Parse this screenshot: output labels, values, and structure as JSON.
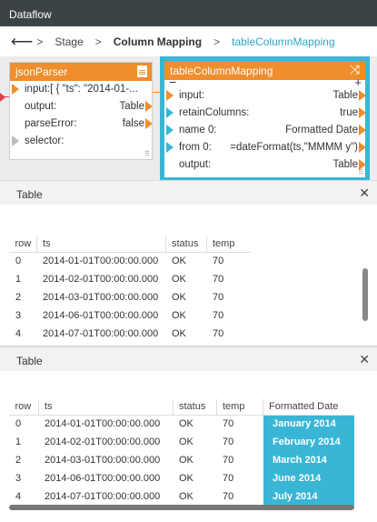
{
  "window": {
    "title": "Dataflow"
  },
  "breadcrumb": {
    "back_icon": "back-arrow-icon",
    "items": [
      "Stage",
      "Column Mapping",
      "tableColumnMapping"
    ]
  },
  "nodes": {
    "json_parser": {
      "title": "jsonParser",
      "rows": [
        {
          "label": "input:",
          "value": "[ { \"ts\": \"2014-01-..."
        },
        {
          "label": "output:",
          "value": "Table"
        },
        {
          "label": "parseError:",
          "value": "false"
        },
        {
          "label": "selector:",
          "value": ""
        }
      ]
    },
    "table_column_mapping": {
      "title": "tableColumnMapping",
      "rows": [
        {
          "label": "input:",
          "value": "Table"
        },
        {
          "label": "retainColumns:",
          "value": "true"
        },
        {
          "label": "name 0:",
          "value": "Formatted Date"
        },
        {
          "label": "from 0:",
          "value": "=dateFormat(ts,\"MMMM y\")"
        },
        {
          "label": "output:",
          "value": "Table"
        }
      ]
    }
  },
  "panels": [
    {
      "title": "Table",
      "columns": [
        "row",
        "ts",
        "status",
        "temp"
      ],
      "rows": [
        [
          "0",
          "2014-01-01T00:00:00.000",
          "OK",
          "70"
        ],
        [
          "1",
          "2014-02-01T00:00:00.000",
          "OK",
          "70"
        ],
        [
          "2",
          "2014-03-01T00:00:00.000",
          "OK",
          "70"
        ],
        [
          "3",
          "2014-06-01T00:00:00.000",
          "OK",
          "70"
        ],
        [
          "4",
          "2014-07-01T00:00:00.000",
          "OK",
          "70"
        ]
      ]
    },
    {
      "title": "Table",
      "columns": [
        "row",
        "ts",
        "status",
        "temp",
        "Formatted Date"
      ],
      "rows": [
        [
          "0",
          "2014-01-01T00:00:00.000",
          "OK",
          "70",
          "January 2014"
        ],
        [
          "1",
          "2014-02-01T00:00:00.000",
          "OK",
          "70",
          "February 2014"
        ],
        [
          "2",
          "2014-03-01T00:00:00.000",
          "OK",
          "70",
          "March 2014"
        ],
        [
          "3",
          "2014-06-01T00:00:00.000",
          "OK",
          "70",
          "June 2014"
        ],
        [
          "4",
          "2014-07-01T00:00:00.000",
          "OK",
          "70",
          "July 2014"
        ]
      ]
    }
  ],
  "colors": {
    "accent": "#39b6d6",
    "node_header": "#f08d2c",
    "titlebar": "#3c4347"
  }
}
